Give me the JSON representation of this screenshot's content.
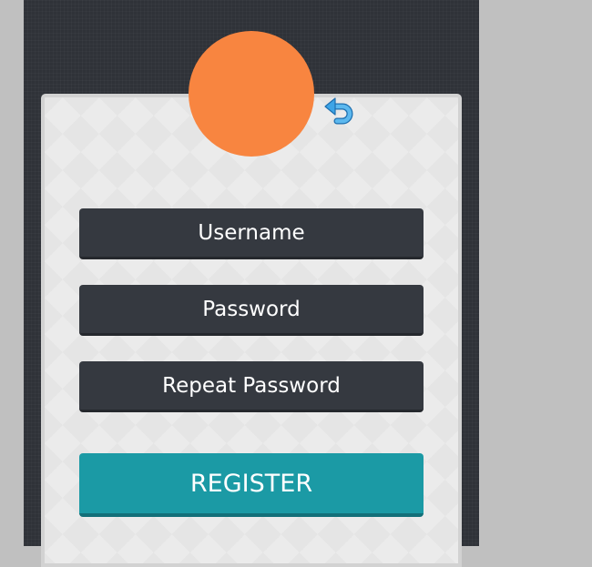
{
  "colors": {
    "page_background": "#c0c0c0",
    "frame_background": "#2f3238",
    "card_background": "#ebebeb",
    "avatar": "#f88540",
    "field_background": "#353940",
    "accent": "#1b9aa5",
    "back_icon": "#3da4e6"
  },
  "avatar": {
    "icon": "user-avatar-circle"
  },
  "back": {
    "icon": "return-arrow-icon"
  },
  "form": {
    "username_placeholder": "Username",
    "password_placeholder": "Password",
    "repeat_password_placeholder": "Repeat Password",
    "register_label": "REGISTER"
  }
}
